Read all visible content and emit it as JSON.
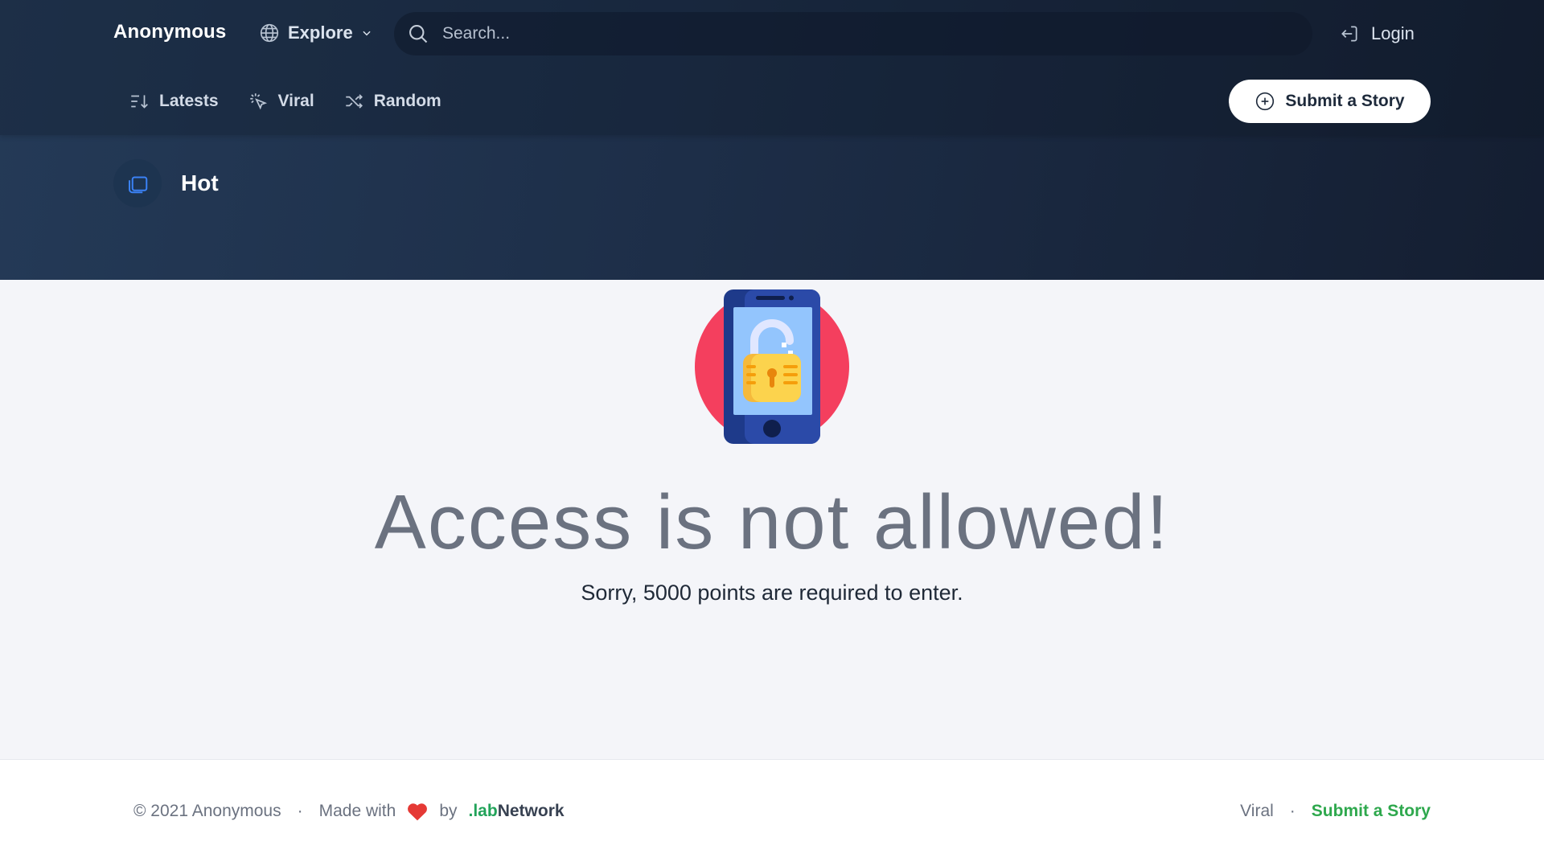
{
  "header": {
    "brand": "Anonymous",
    "explore_label": "Explore",
    "search_placeholder": "Search...",
    "login_label": "Login"
  },
  "nav": {
    "items": [
      {
        "label": "Latests",
        "icon": "sort-descending-icon"
      },
      {
        "label": "Viral",
        "icon": "sparkle-click-icon"
      },
      {
        "label": "Random",
        "icon": "shuffle-icon"
      }
    ],
    "submit_label": "Submit a Story"
  },
  "section": {
    "title": "Hot",
    "icon": "folders-icon"
  },
  "message": {
    "headline": "Access is not allowed!",
    "subline": "Sorry, 5000 points are required to enter.",
    "illustration": "phone-padlock-illustration"
  },
  "footer": {
    "copyright": "© 2021 Anonymous",
    "made_with": "Made with",
    "by": "by",
    "brand_prefix": ".lab",
    "brand_suffix": "Network",
    "links": [
      "Viral",
      "Submit a Story"
    ]
  },
  "colors": {
    "hero_dark": "#141e31",
    "hero_light": "#243a57",
    "accent_green": "#2ea84d",
    "heart_red": "#e53935",
    "circle_red": "#f43f5e",
    "phone_blue": "#1e3a8a"
  }
}
